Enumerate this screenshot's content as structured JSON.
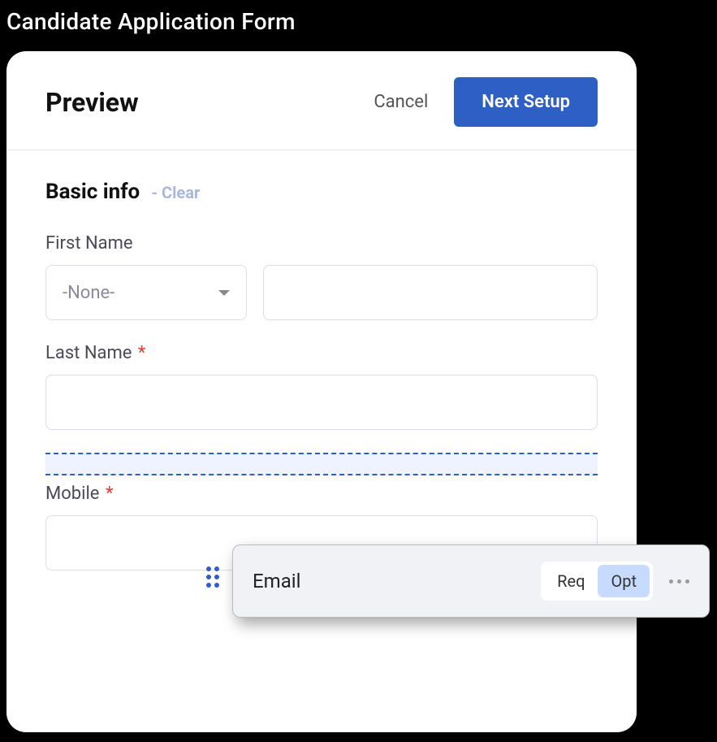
{
  "page": {
    "title": "Candidate Application Form"
  },
  "header": {
    "title": "Preview",
    "cancel_label": "Cancel",
    "next_label": "Next Setup"
  },
  "section": {
    "title": "Basic info",
    "clear_label": "- Clear"
  },
  "fields": {
    "first_name": {
      "label": "First Name",
      "select_value": "-None-",
      "input_value": ""
    },
    "last_name": {
      "label": "Last Name",
      "required": true,
      "value": ""
    },
    "mobile": {
      "label": "Mobile",
      "required": true,
      "value": ""
    }
  },
  "drag_item": {
    "label": "Email",
    "req_label": "Req",
    "opt_label": "Opt",
    "active": "opt"
  },
  "required_mark": "*"
}
